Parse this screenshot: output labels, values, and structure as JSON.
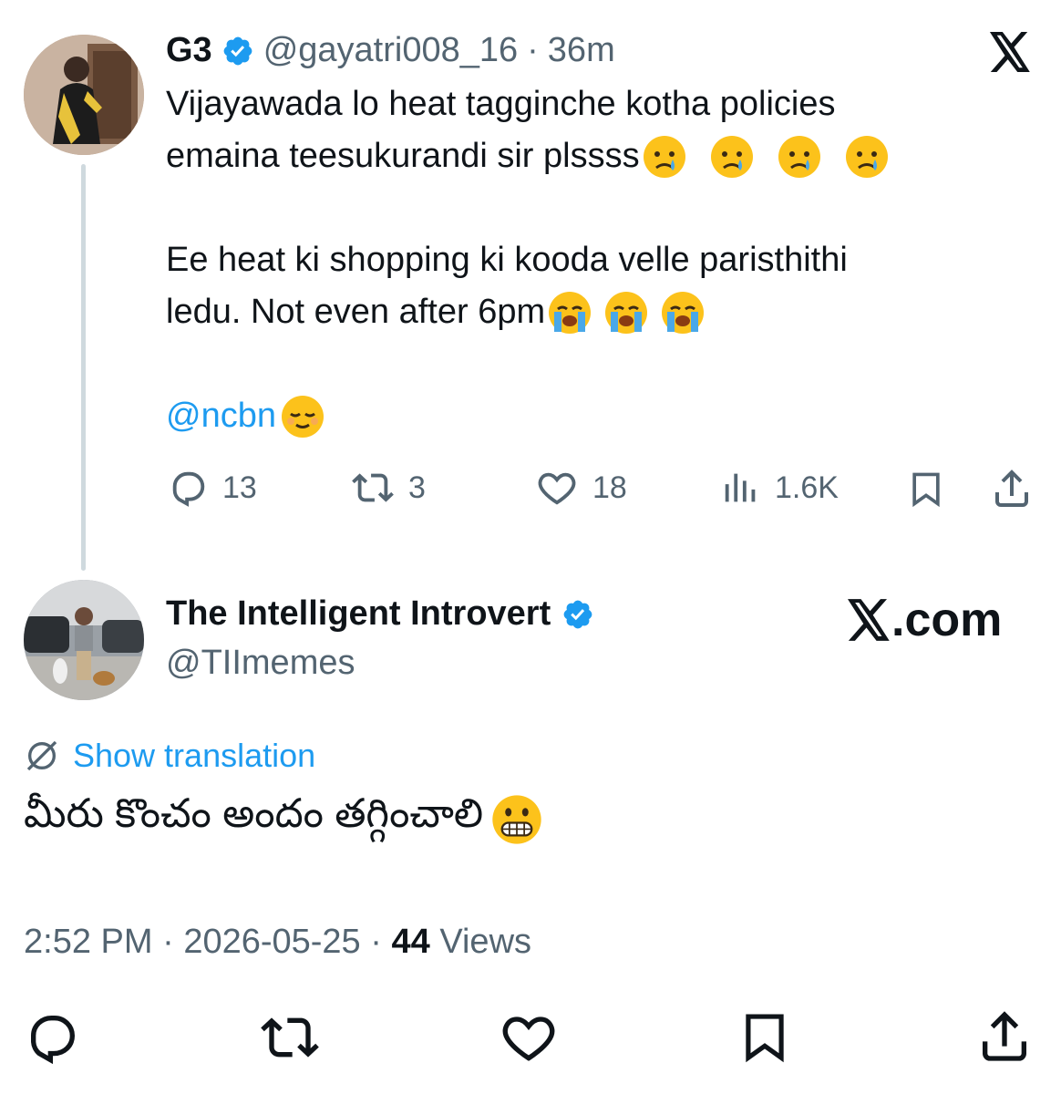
{
  "tweet": {
    "author_name": "G3",
    "author_handle": "@gayatri008_16",
    "separator": "·",
    "time_ago": "36m",
    "text_line1": "Vijayawada lo heat tagginche kotha policies",
    "text_line2": "emaina teesukurandi sir plssss",
    "text_line3": "Ee heat ki shopping ki kooda velle paristhithi",
    "text_line4": "ledu. Not even after 6pm",
    "mention": "@ncbn",
    "stats": {
      "replies": "13",
      "reposts": "3",
      "likes": "18",
      "views": "1.6K"
    }
  },
  "reply": {
    "author_name": "The Intelligent Introvert",
    "author_handle": "@TIImemes",
    "watermark": ".com",
    "show_translation": "Show translation",
    "text": "మీరు కొంచం అందం తగ్గించాలి",
    "time": "2:52 PM",
    "sep1": "·",
    "date": "2026-05-25",
    "sep2": "·",
    "views_count": "44",
    "views_label": "Views"
  },
  "colors": {
    "accent": "#1d9bf0",
    "muted": "#536471",
    "text": "#0f1419",
    "thread_line": "#cfd9de"
  },
  "icons": [
    "verified-badge-icon",
    "x-logo-icon",
    "reply-icon",
    "repost-icon",
    "like-icon",
    "views-icon",
    "bookmark-icon",
    "share-icon",
    "translate-icon",
    "crying-face-emoji",
    "loudly-crying-face-emoji",
    "relieved-face-emoji",
    "grimacing-face-emoji"
  ]
}
